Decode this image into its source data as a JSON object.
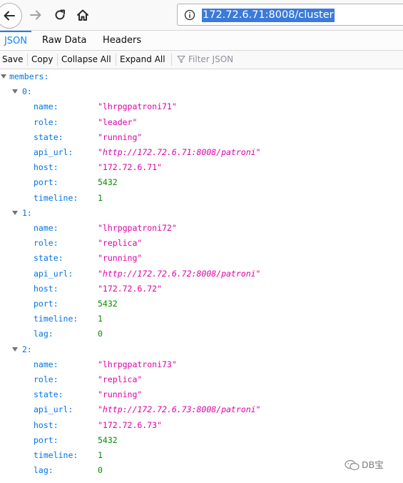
{
  "browser": {
    "url": "172.72.6.71:8008/cluster",
    "icons": {
      "back": "back-arrow-icon",
      "forward": "forward-arrow-icon",
      "reload": "reload-icon",
      "home": "home-icon",
      "info": "info-icon"
    }
  },
  "tabs": [
    {
      "label": "JSON",
      "active": true
    },
    {
      "label": "Raw Data",
      "active": false
    },
    {
      "label": "Headers",
      "active": false
    }
  ],
  "json_toolbar": {
    "save": "Save",
    "copy": "Copy",
    "collapse_all": "Collapse All",
    "expand_all": "Expand All",
    "filter_placeholder": "Filter JSON"
  },
  "tree": {
    "root_key": "members:",
    "members": [
      {
        "index": "0:",
        "fields": [
          {
            "key": "name:",
            "value": "\"lhrpgpatroni71\"",
            "type": "str"
          },
          {
            "key": "role:",
            "value": "\"leader\"",
            "type": "str"
          },
          {
            "key": "state:",
            "value": "\"running\"",
            "type": "str"
          },
          {
            "key": "api_url:",
            "value": "\"http://172.72.6.71:8008/patroni\"",
            "type": "url"
          },
          {
            "key": "host:",
            "value": "\"172.72.6.71\"",
            "type": "str"
          },
          {
            "key": "port:",
            "value": "5432",
            "type": "num"
          },
          {
            "key": "timeline:",
            "value": "1",
            "type": "num"
          }
        ]
      },
      {
        "index": "1:",
        "fields": [
          {
            "key": "name:",
            "value": "\"lhrpgpatroni72\"",
            "type": "str"
          },
          {
            "key": "role:",
            "value": "\"replica\"",
            "type": "str"
          },
          {
            "key": "state:",
            "value": "\"running\"",
            "type": "str"
          },
          {
            "key": "api_url:",
            "value": "\"http://172.72.6.72:8008/patroni\"",
            "type": "url"
          },
          {
            "key": "host:",
            "value": "\"172.72.6.72\"",
            "type": "str"
          },
          {
            "key": "port:",
            "value": "5432",
            "type": "num"
          },
          {
            "key": "timeline:",
            "value": "1",
            "type": "num"
          },
          {
            "key": "lag:",
            "value": "0",
            "type": "num"
          }
        ]
      },
      {
        "index": "2:",
        "fields": [
          {
            "key": "name:",
            "value": "\"lhrpgpatroni73\"",
            "type": "str"
          },
          {
            "key": "role:",
            "value": "\"replica\"",
            "type": "str"
          },
          {
            "key": "state:",
            "value": "\"running\"",
            "type": "str"
          },
          {
            "key": "api_url:",
            "value": "\"http://172.72.6.73:8008/patroni\"",
            "type": "url"
          },
          {
            "key": "host:",
            "value": "\"172.72.6.73\"",
            "type": "str"
          },
          {
            "key": "port:",
            "value": "5432",
            "type": "num"
          },
          {
            "key": "timeline:",
            "value": "1",
            "type": "num"
          },
          {
            "key": "lag:",
            "value": "0",
            "type": "num"
          }
        ]
      }
    ]
  },
  "watermark": {
    "text": "DB宝",
    "icon": "wechat-icon"
  },
  "colors": {
    "key": "#0074e8",
    "string": "#dd00a9",
    "number": "#058b00",
    "url_highlight": "#3b7ad9",
    "active_tab": "#0a84ff"
  }
}
